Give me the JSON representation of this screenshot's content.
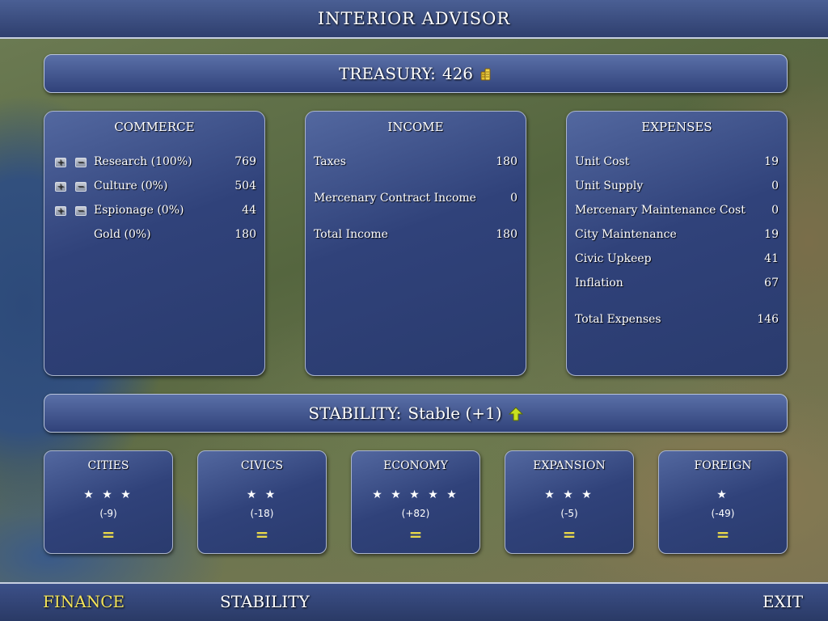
{
  "header": {
    "title": "INTERIOR ADVISOR"
  },
  "treasury": {
    "label": "TREASURY:",
    "value": "426",
    "icon": "gold-coins-icon"
  },
  "commerce": {
    "title": "COMMERCE",
    "rows": [
      {
        "name": "Research (100%)",
        "value": "769"
      },
      {
        "name": "Culture (0%)",
        "value": "504"
      },
      {
        "name": "Espionage (0%)",
        "value": "44"
      },
      {
        "name": "Gold (0%)",
        "value": "180"
      }
    ]
  },
  "income": {
    "title": "INCOME",
    "rows": [
      {
        "name": "Taxes",
        "value": "180"
      },
      {
        "name": "Mercenary Contract Income",
        "value": "0"
      },
      {
        "name": "Total Income",
        "value": "180"
      }
    ]
  },
  "expenses": {
    "title": "EXPENSES",
    "rows": [
      {
        "name": "Unit Cost",
        "value": "19"
      },
      {
        "name": "Unit Supply",
        "value": "0"
      },
      {
        "name": "Mercenary Maintenance Cost",
        "value": "0"
      },
      {
        "name": "City Maintenance",
        "value": "19"
      },
      {
        "name": "Civic Upkeep",
        "value": "41"
      },
      {
        "name": "Inflation",
        "value": "67"
      },
      {
        "name": "Total Expenses",
        "value": "146"
      }
    ]
  },
  "stability": {
    "label": "STABILITY:",
    "value": "Stable (+1)",
    "trend": "up",
    "trend_color": "#c8e020"
  },
  "categories": [
    {
      "title": "CITIES",
      "stars": 3,
      "stars_text": "★ ★ ★",
      "delta": "(-9)",
      "trend": "="
    },
    {
      "title": "CIVICS",
      "stars": 2,
      "stars_text": "★ ★",
      "delta": "(-18)",
      "trend": "="
    },
    {
      "title": "ECONOMY",
      "stars": 5,
      "stars_text": "★ ★ ★ ★ ★",
      "delta": "(+82)",
      "trend": "="
    },
    {
      "title": "EXPANSION",
      "stars": 3,
      "stars_text": "★ ★ ★",
      "delta": "(-5)",
      "trend": "="
    },
    {
      "title": "FOREIGN",
      "stars": 1,
      "stars_text": "★",
      "delta": "(-49)",
      "trend": "="
    }
  ],
  "nav": {
    "finance": "FINANCE",
    "stability": "STABILITY",
    "exit": "EXIT",
    "active": "finance",
    "active_color": "#f2e35a"
  }
}
